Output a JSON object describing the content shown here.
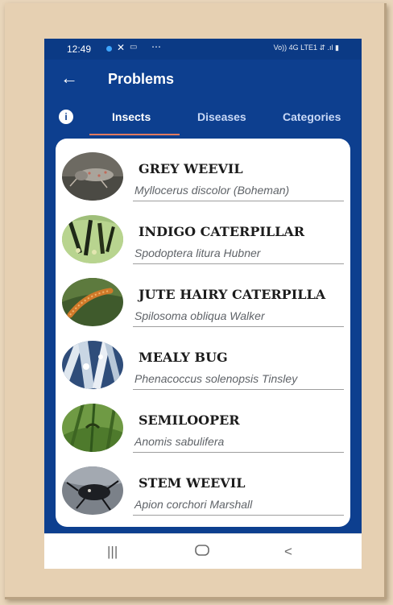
{
  "status_bar": {
    "time": "12:49",
    "right_info": "Vo)) 4G LTE1 ⇵ .ıl ▮"
  },
  "app_bar": {
    "back_icon": "arrow-left-icon",
    "title": "Problems"
  },
  "tabs": {
    "info_icon": "info-icon",
    "items": [
      {
        "label": "Insects",
        "selected": true
      },
      {
        "label": "Diseases",
        "selected": false
      },
      {
        "label": "Categories",
        "selected": false
      }
    ],
    "indicator_color": "#e07a5f"
  },
  "list": [
    {
      "name": "GREY WEEVIL",
      "scientific": "Myllocerus discolor (Boheman)",
      "image": "grey-weevil-photo"
    },
    {
      "name": "INDIGO CATERPILLAR",
      "scientific": "Spodoptera litura Hubner",
      "image": "indigo-caterpillar-photo"
    },
    {
      "name": "JUTE HAIRY CATERPILLA",
      "scientific": "Spilosoma obliqua Walker",
      "image": "jute-hairy-caterpillar-photo"
    },
    {
      "name": "MEALY BUG",
      "scientific": "Phenacoccus solenopsis Tinsley",
      "image": "mealy-bug-photo"
    },
    {
      "name": "SEMILOOPER",
      "scientific": "Anomis sabulifera",
      "image": "semilooper-photo"
    },
    {
      "name": "STEM WEEVIL",
      "scientific": "Apion corchori Marshall",
      "image": "stem-weevil-photo"
    }
  ],
  "nav": {
    "recents": "|||",
    "home": "home-button-icon",
    "back": "<"
  },
  "colors": {
    "header_blue": "#0d3f8f",
    "frame_beige": "#e6d0b2"
  }
}
